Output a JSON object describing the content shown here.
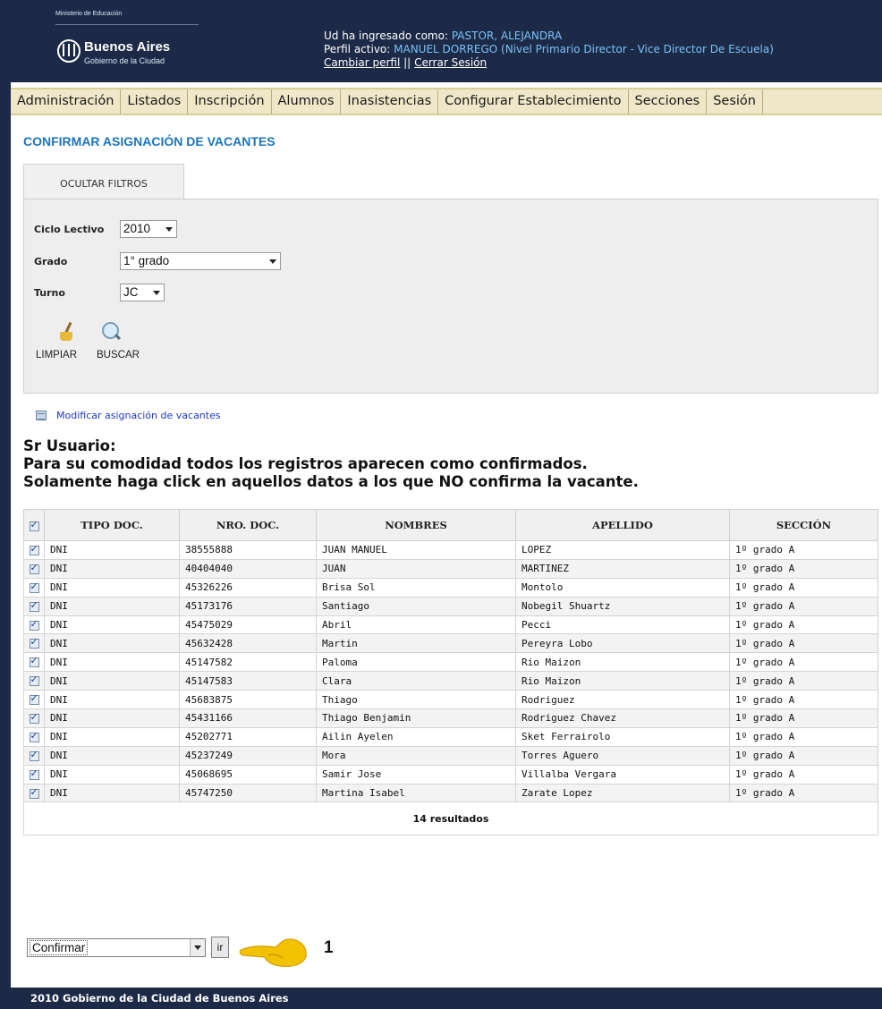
{
  "header": {
    "ministry": "Ministerio de Educación",
    "brand": "Buenos Aires",
    "brand_sub": "Gobierno de la Ciudad",
    "logged_label": "Ud ha ingresado como:",
    "logged_user": "PASTOR, ALEJANDRA",
    "profile_label": "Perfil activo:",
    "profile_value": "MANUEL DORREGO (Nivel Primario Director - Vice Director De Escuela)",
    "change_profile": "Cambiar perfil",
    "separator": "||",
    "logout": "Cerrar Sesión"
  },
  "nav": [
    "Administración",
    "Listados",
    "Inscripción",
    "Alumnos",
    "Inasistencias",
    "Configurar Establecimiento",
    "Secciones",
    "Sesión"
  ],
  "page_title": "CONFIRMAR ASIGNACIÓN DE VACANTES",
  "filters": {
    "tab_label": "OCULTAR FILTROS",
    "ciclo_label": "Ciclo Lectivo",
    "ciclo_value": "2010",
    "grado_label": "Grado",
    "grado_value": "1° grado",
    "turno_label": "Turno",
    "turno_value": "JC",
    "clear_label": "LIMPIAR",
    "search_label": "BUSCAR"
  },
  "modify_link": "Modificar asignación de vacantes",
  "notice": {
    "line1": "Sr Usuario:",
    "line2": "Para su comodidad todos los registros aparecen como confirmados.",
    "line3": "Solamente haga click en aquellos datos a los que NO confirma la vacante."
  },
  "table": {
    "headers": [
      "TIPO DOC.",
      "NRO. DOC.",
      "NOMBRES",
      "APELLIDO",
      "SECCIÓN"
    ],
    "rows": [
      {
        "tipo": "DNI",
        "nro": "38555888",
        "nombres": "JUAN MANUEL",
        "apellido": "LOPEZ",
        "seccion": "1º grado A"
      },
      {
        "tipo": "DNI",
        "nro": "40404040",
        "nombres": "JUAN",
        "apellido": "MARTINEZ",
        "seccion": "1º grado A"
      },
      {
        "tipo": "DNI",
        "nro": "45326226",
        "nombres": "Brisa Sol",
        "apellido": "Montolo",
        "seccion": "1º grado A"
      },
      {
        "tipo": "DNI",
        "nro": "45173176",
        "nombres": "Santiago",
        "apellido": "Nobegil Shuartz",
        "seccion": "1º grado A"
      },
      {
        "tipo": "DNI",
        "nro": "45475029",
        "nombres": "Abril",
        "apellido": "Pecci",
        "seccion": "1º grado A"
      },
      {
        "tipo": "DNI",
        "nro": "45632428",
        "nombres": "Martin",
        "apellido": "Pereyra Lobo",
        "seccion": "1º grado A"
      },
      {
        "tipo": "DNI",
        "nro": "45147582",
        "nombres": "Paloma",
        "apellido": "Rio Maizon",
        "seccion": "1º grado A"
      },
      {
        "tipo": "DNI",
        "nro": "45147583",
        "nombres": "Clara",
        "apellido": "Rio Maizon",
        "seccion": "1º grado A"
      },
      {
        "tipo": "DNI",
        "nro": "45683875",
        "nombres": "Thiago",
        "apellido": "Rodriguez",
        "seccion": "1º grado A"
      },
      {
        "tipo": "DNI",
        "nro": "45431166",
        "nombres": "Thiago Benjamin",
        "apellido": "Rodriguez Chavez",
        "seccion": "1º grado A"
      },
      {
        "tipo": "DNI",
        "nro": "45202771",
        "nombres": "Ailin Ayelen",
        "apellido": "Sket Ferrairolo",
        "seccion": "1º grado A"
      },
      {
        "tipo": "DNI",
        "nro": "45237249",
        "nombres": "Mora",
        "apellido": "Torres Aguero",
        "seccion": "1º grado A"
      },
      {
        "tipo": "DNI",
        "nro": "45068695",
        "nombres": "Samir Jose",
        "apellido": "Villalba Vergara",
        "seccion": "1º grado A"
      },
      {
        "tipo": "DNI",
        "nro": "45747250",
        "nombres": "Martina Isabel",
        "apellido": "Zarate Lopez",
        "seccion": "1º grado A"
      }
    ],
    "results": "14 resultados"
  },
  "actions": {
    "select_value": "Confirmar",
    "go_label": "ir",
    "callout": "1"
  },
  "footer": "2010 Gobierno de la Ciudad de Buenos Aires",
  "colors": {
    "header_bg": "#1c2a47",
    "nav_bg": "#efe7c7",
    "title": "#1c74bd",
    "link": "#1f36c9",
    "highlight": "#7ac2f6",
    "pointer": "#f2c100"
  }
}
